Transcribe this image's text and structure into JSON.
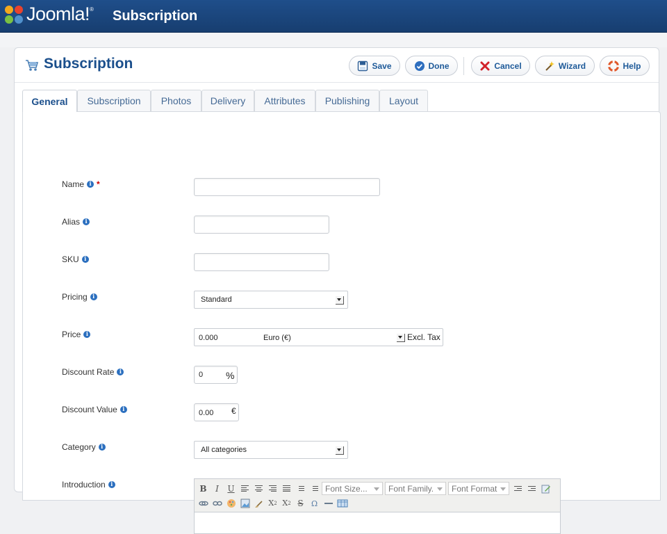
{
  "header": {
    "brand": "Joomla!",
    "brand_mark": "®",
    "app_title": "Subscription"
  },
  "toolbar": {
    "title": "Subscription",
    "buttons": {
      "save": "Save",
      "done": "Done",
      "cancel": "Cancel",
      "wizard": "Wizard",
      "help": "Help"
    }
  },
  "tabs": [
    "General",
    "Subscription",
    "Photos",
    "Delivery",
    "Attributes",
    "Publishing",
    "Layout"
  ],
  "form": {
    "name": {
      "label": "Name",
      "value": ""
    },
    "alias": {
      "label": "Alias",
      "value": ""
    },
    "sku": {
      "label": "SKU",
      "value": ""
    },
    "pricing": {
      "label": "Pricing",
      "value": "Standard"
    },
    "price": {
      "label": "Price",
      "value": "0.000",
      "currency": "Euro (€)",
      "tax": "Excl. Tax"
    },
    "discount_rate": {
      "label": "Discount Rate",
      "value": "0",
      "unit": "%"
    },
    "discount_value": {
      "label": "Discount Value",
      "value": "0.00",
      "unit": "€"
    },
    "category": {
      "label": "Category",
      "value": "All categories"
    },
    "introduction": {
      "label": "Introduction"
    }
  },
  "editor": {
    "font_size": "Font Size...",
    "font_family": "Font Family.",
    "font_format": "Font Format",
    "bold": "B",
    "italic": "I",
    "underline": "U"
  },
  "colors": {
    "header_bg": "#1f4e8a",
    "accent": "#1b4f8c",
    "required": "#cc0000"
  }
}
